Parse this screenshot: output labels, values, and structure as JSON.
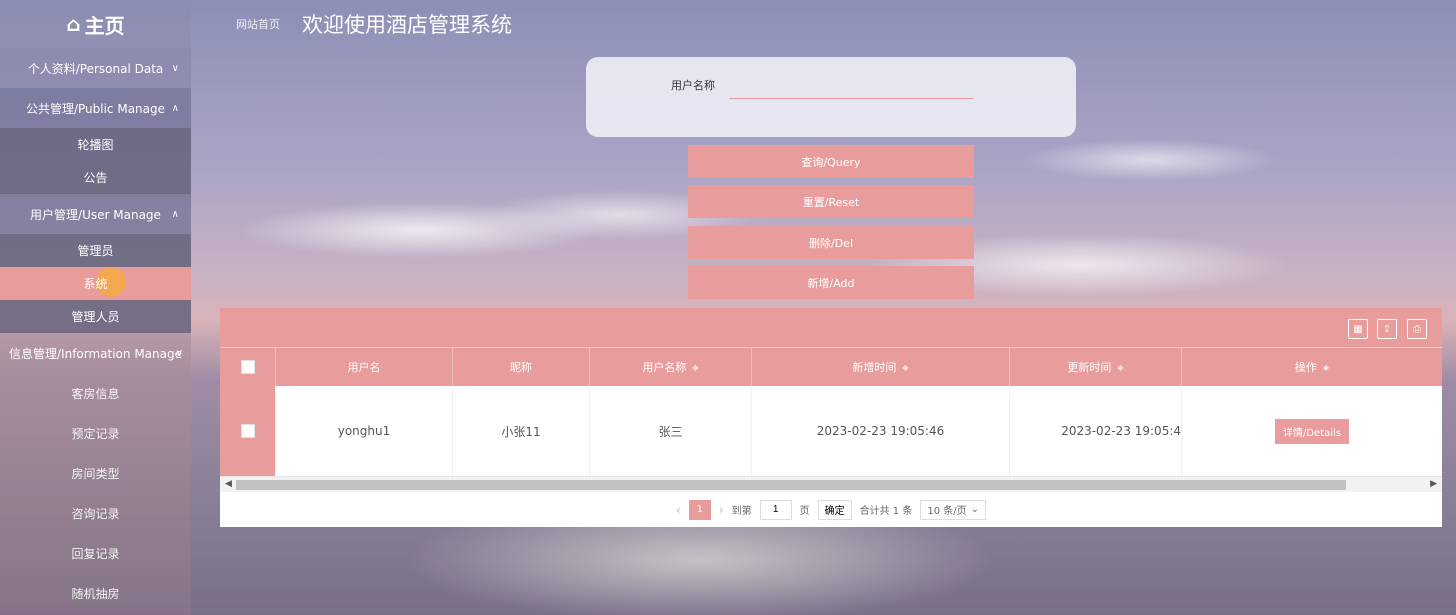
{
  "header": {
    "logo_icon": "home-icon",
    "logo_text": "主页",
    "breadcrumb": "网站首页",
    "title": "欢迎使用酒店管理系统"
  },
  "sidebar": {
    "personal": "个人资料/Personal Data",
    "public": "公共管理/Public Manage",
    "public_items": [
      "轮播图",
      "公告"
    ],
    "user": "用户管理/User Manage",
    "user_items": [
      "管理员",
      "系统",
      "管理人员"
    ],
    "info": "信息管理/Information Manage",
    "info_items": [
      "客房信息",
      "预定记录",
      "房间类型",
      "咨询记录",
      "回复记录",
      "随机抽房"
    ]
  },
  "search": {
    "label": "用户名称",
    "value": ""
  },
  "buttons": {
    "query": "查询/Query",
    "reset": "重置/Reset",
    "delete": "删除/Del",
    "add": "新增/Add"
  },
  "table": {
    "headers": [
      "用户名",
      "昵称",
      "用户名称",
      "新增时间",
      "更新时间",
      "操作"
    ],
    "rows": [
      {
        "username": "yonghu1",
        "nickname": "小张11",
        "name": "张三",
        "created": "2023-02-23 19:05:46",
        "updated": "2023-02-23 19:05:4",
        "action": "详情/Details"
      }
    ]
  },
  "pagination": {
    "current": "1",
    "goto_label": "到第",
    "goto_value": "1",
    "page_unit": "页",
    "confirm": "确定",
    "total": "合计共 1 条",
    "page_size": "10 条/页"
  },
  "colors": {
    "accent": "#e89c9c"
  }
}
